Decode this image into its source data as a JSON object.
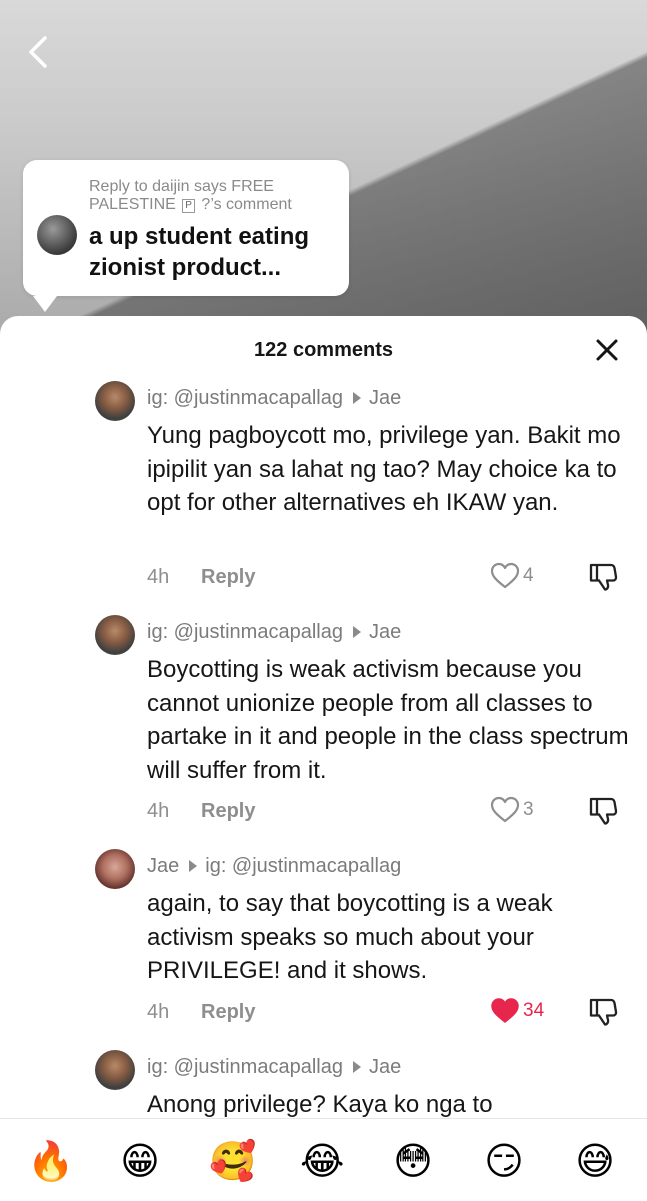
{
  "reply_card": {
    "meta_line1": "Reply to daijin says FREE",
    "meta_line2_pre": "PALESTINE",
    "meta_badge": "P",
    "meta_line2_post": "?’s comment",
    "text": "a up student eating zionist product..."
  },
  "sheet": {
    "title": "122 comments"
  },
  "comments": [
    {
      "author": "ig: @justinmacapallag",
      "reply_to": "Jae",
      "text": "Yung pagboycott mo, privilege yan. Bakit mo ipipilit yan sa lahat ng tao? May choice ka to opt for other alternatives eh IKAW yan.",
      "time": "4h",
      "reply_label": "Reply",
      "likes": "4",
      "liked": false
    },
    {
      "author": "ig: @justinmacapallag",
      "reply_to": "Jae",
      "text": "Boycotting is weak activism because you cannot unionize people from all classes to partake in it and people in the class spectrum will suffer from it.",
      "time": "4h",
      "reply_label": "Reply",
      "likes": "3",
      "liked": false
    },
    {
      "author": "Jae",
      "reply_to": "ig: @justinmacapallag",
      "text": "again, to say that boycotting is a weak activism speaks so much about your PRIVILEGE! and it shows.",
      "time": "4h",
      "reply_label": "Reply",
      "likes": "34",
      "liked": true
    },
    {
      "author": "ig: @justinmacapallag",
      "reply_to": "Jae",
      "text": "Anong privilege? Kaya ko nga to"
    }
  ],
  "emojis": [
    "🔥",
    "😁",
    "🥰",
    "😂",
    "😳",
    "😏",
    "😅"
  ],
  "colors": {
    "liked": "#e8254d",
    "muted": "#8e8e8e"
  }
}
